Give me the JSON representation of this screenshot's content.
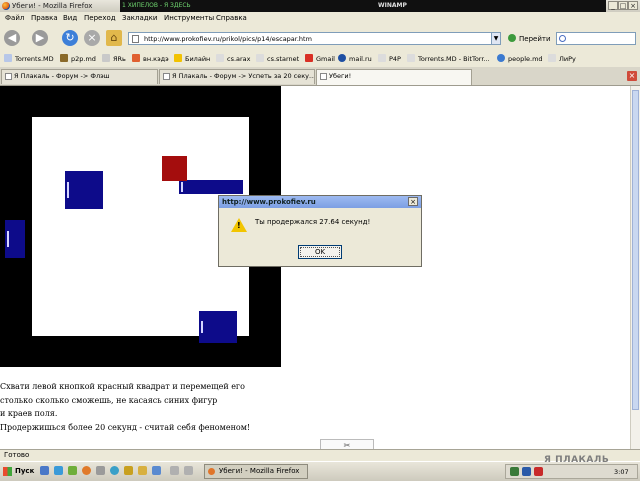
{
  "window": {
    "title": "Убеги! - Mozilla Firefox",
    "overlay_text_1": "1 ХИПЕЛОВ - Я ЗДЕСЬ",
    "overlay_text_2": "WINAMP"
  },
  "menu": [
    "Файл",
    "Правка",
    "Вид",
    "Переход",
    "Закладки",
    "Инструменты",
    "Справка"
  ],
  "navigation": {
    "url": "http://www.prokofiev.ru/prikol/pics/p14/escapar.htm",
    "go_label": "Перейти",
    "search_value": ""
  },
  "bookmarks": [
    "Torrents.MD",
    "p2p.md",
    "ЯRь",
    "вн.кэдэ",
    "Билайн",
    "cs.arax",
    "cs.starnet",
    "Gmail",
    "mail.ru",
    "P4P",
    "Torrents.MD - BitTorr...",
    "people.md",
    "ЛиРу"
  ],
  "tabs": [
    {
      "label": "Я Плакаль - Форум -> Флэш",
      "active": false
    },
    {
      "label": "Я Плакаль - Форум -> Успеть за 20 секу...",
      "active": false
    },
    {
      "label": "Убеги!",
      "active": true
    }
  ],
  "game": {
    "colors": {
      "frame": "#000000",
      "field": "#ffffff",
      "blue": "#0d0b8a",
      "red": "#a40d0d"
    }
  },
  "instructions": [
    "Схвати левой кнопкой красный квадрат и перемещей его",
    "столько сколько сможешь, не касаясь синих фигур",
    "и краев поля.",
    "Продержишься более 20 секунд - считай себя феноменом!"
  ],
  "alert": {
    "title": "http://www.prokofiev.ru",
    "message": "Ты продержался 27.64 секунд!",
    "ok_label": "OK"
  },
  "status": "Готово",
  "taskbar": {
    "start_label": "Пуск",
    "task_label": "Убеги! - Mozilla Firefox",
    "watermark": "Я ПЛАКАЛЬ",
    "clock": "3:07"
  }
}
